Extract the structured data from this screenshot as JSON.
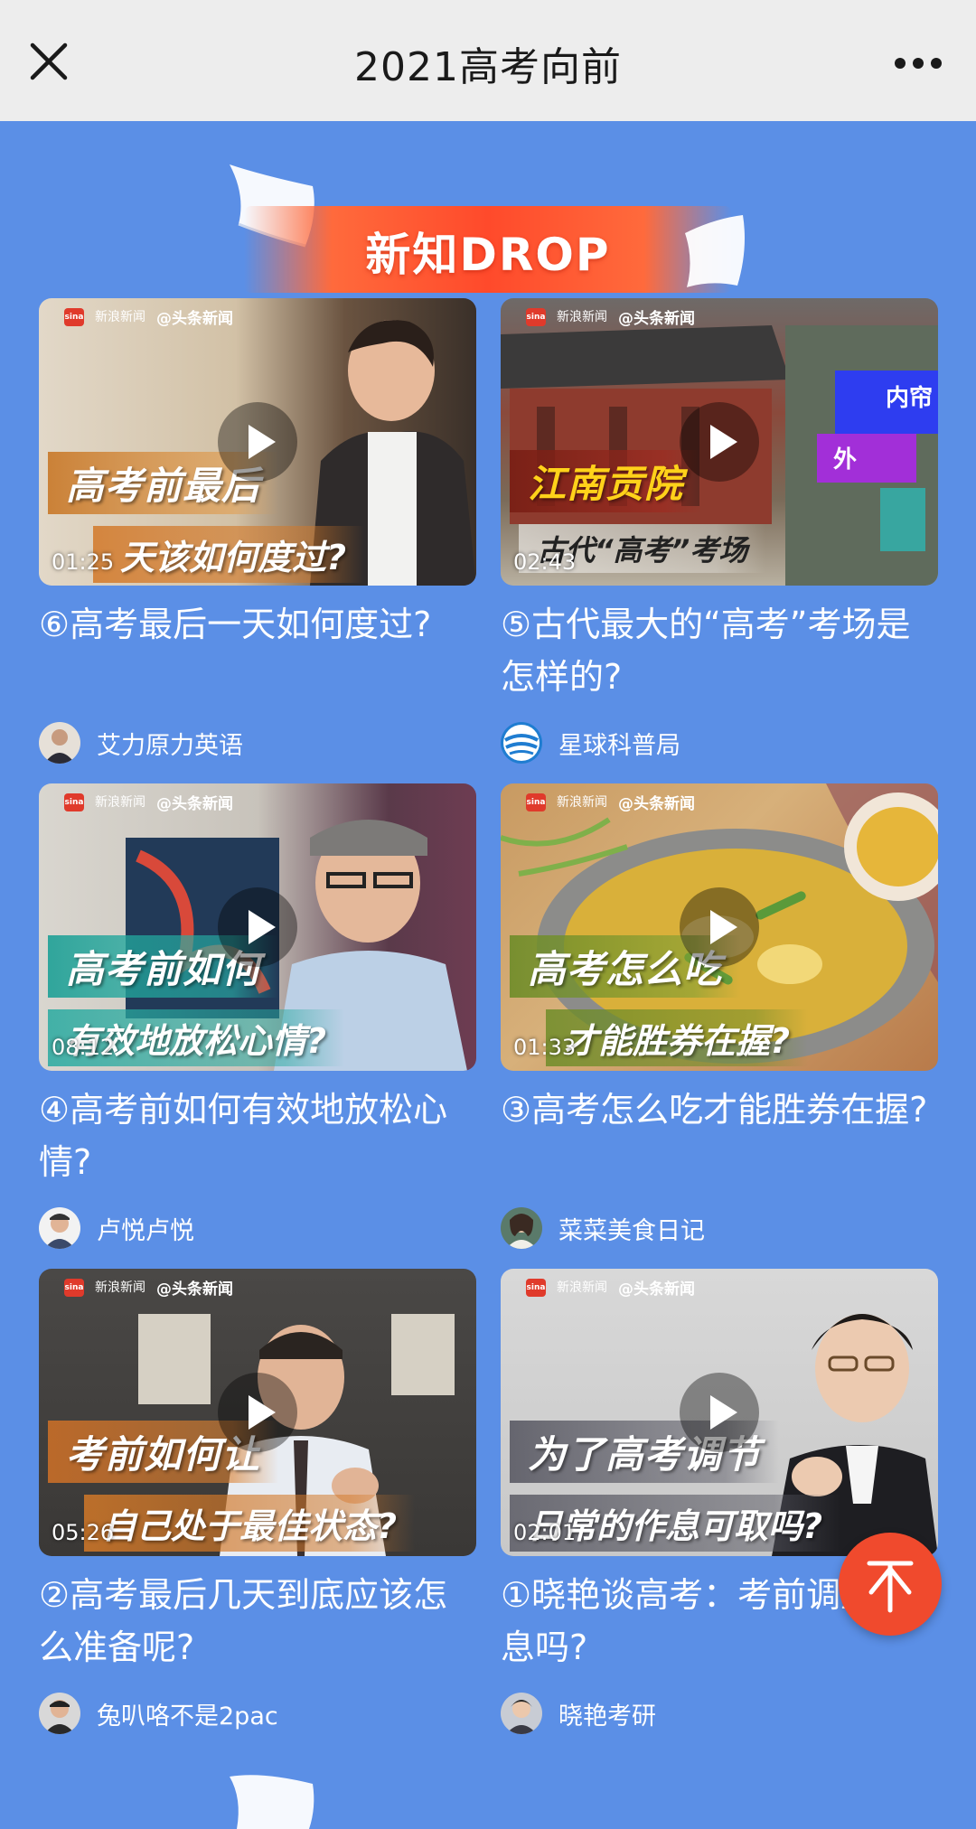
{
  "topbar": {
    "title": "2021高考向前",
    "close_icon": "close-icon",
    "more_icon": "more-horizontal-icon"
  },
  "banner": {
    "text": "新知DROP"
  },
  "source": {
    "sina_cn": "新浪新闻",
    "sina_en": "Sina News",
    "toutiao": "@头条新闻"
  },
  "cards": [
    {
      "caption1": "高考前最后",
      "caption2": "天该如何度过?",
      "duration": "01:25",
      "title": "⑥高考最后一天如何度过?",
      "author": "艾力原力英语"
    },
    {
      "caption1": "江南贡院",
      "caption2": "古代“高考”考场",
      "duration": "02:43",
      "title": "⑤古代最大的“高考”考场是怎样的?",
      "author": "星球科普局",
      "map_labels": [
        "内帘",
        "外"
      ]
    },
    {
      "caption1": "高考前如何",
      "caption2": "有效地放松心情?",
      "duration": "08:12",
      "title": "④高考前如何有效地放松心情?",
      "author": "卢悦卢悦"
    },
    {
      "caption1": "高考怎么吃",
      "caption2": "才能胜券在握?",
      "duration": "01:33",
      "title": "③高考怎么吃才能胜券在握?",
      "author": "菜菜美食日记"
    },
    {
      "caption1": "考前如何让",
      "caption2": "自己处于最佳状态?",
      "duration": "05:26",
      "title": "②高考最后几天到底应该怎么准备呢?",
      "author": "兔叭咯不是2pac"
    },
    {
      "caption1": "为了高考调节",
      "caption2": "日常的作息可取吗?",
      "duration": "02:01",
      "title": "①晓艳谈高考：考前调整作息吗?",
      "author": "晓艳考研"
    }
  ],
  "backtop": {
    "icon": "arrow-up-icon"
  },
  "colors": {
    "page_bg": "#5b8fe6",
    "topbar_bg": "#ededed",
    "accent": "#f04a2d"
  }
}
